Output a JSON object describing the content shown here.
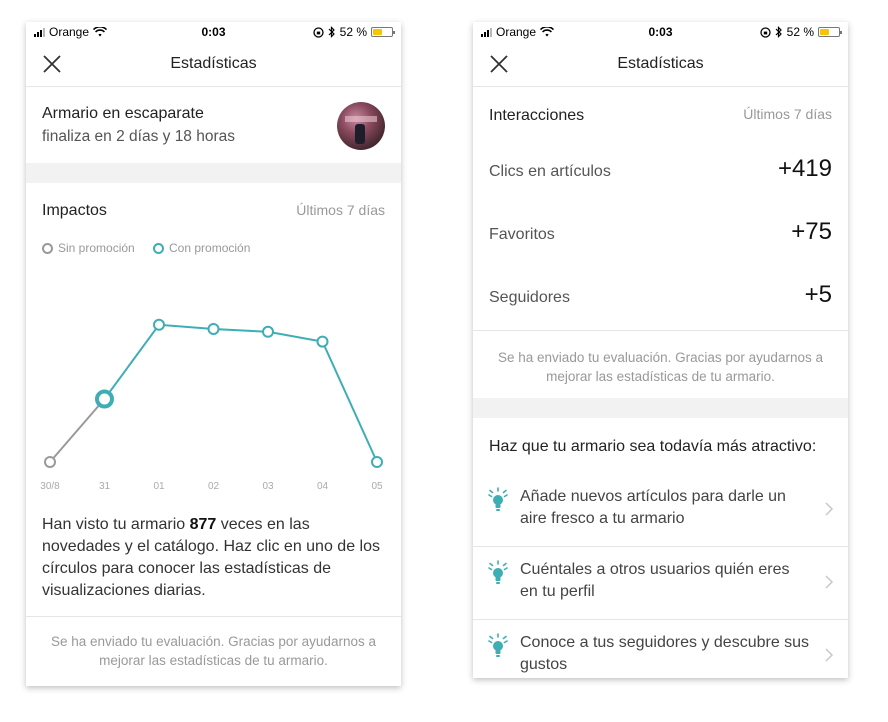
{
  "status_bar": {
    "carrier": "Orange",
    "time": "0:03",
    "battery": "52 %",
    "battery_level": 0.52
  },
  "left_screen": {
    "title": "Estadísticas",
    "armario": {
      "title": "Armario en escaparate",
      "subtitle": "finaliza en 2 días y 18 horas"
    },
    "impactos": {
      "title": "Impactos",
      "range": "Últimos 7 días",
      "legend": [
        "Sin promoción",
        "Con promoción"
      ],
      "text_prefix": "Han visto tu armario ",
      "count": "877",
      "text_suffix": " veces en las novedades y el catálogo. Haz clic en uno de los círculos para conocer las estadísticas de visualizaciones diarias."
    },
    "feedback": "Se ha enviado tu evaluación. Gracias por ayudarnos a mejorar las estadísticas de tu armario."
  },
  "chart_data": {
    "type": "line",
    "categories": [
      "30/8",
      "31",
      "01",
      "02",
      "03",
      "04",
      "05"
    ],
    "series": [
      {
        "name": "Sin promoción",
        "values": [
          0.0,
          0.45,
          null,
          null,
          null,
          null,
          null
        ]
      },
      {
        "name": "Con promoción",
        "values": [
          null,
          0.45,
          0.98,
          0.95,
          0.93,
          0.86,
          0.0
        ]
      }
    ],
    "selected_index": 1,
    "ylim": [
      0,
      1
    ],
    "colors": {
      "sin": "#9a9a9a",
      "con": "#3eaeb5"
    }
  },
  "right_screen": {
    "title": "Estadísticas",
    "interacciones": {
      "title": "Interacciones",
      "range": "Últimos 7 días",
      "rows": [
        {
          "label": "Clics en artículos",
          "value": "+419"
        },
        {
          "label": "Favoritos",
          "value": "+75"
        },
        {
          "label": "Seguidores",
          "value": "+5"
        }
      ]
    },
    "feedback": "Se ha enviado tu evaluación. Gracias por ayudarnos a mejorar las estadísticas de tu armario.",
    "tips_title": "Haz que tu armario sea todavía más atractivo:",
    "tips": [
      {
        "text": "Añade nuevos artículos para darle un aire fresco a tu armario",
        "icon": "lightbulb-icon"
      },
      {
        "text": "Cuéntales a otros usuarios quién eres en tu perfil",
        "icon": "lightbulb-icon"
      },
      {
        "text": "Conoce a tus seguidores y descubre sus gustos",
        "icon": "lightbulb-icon"
      }
    ]
  },
  "colors": {
    "accent": "#3eaeb5",
    "battery": "#f7c600"
  }
}
